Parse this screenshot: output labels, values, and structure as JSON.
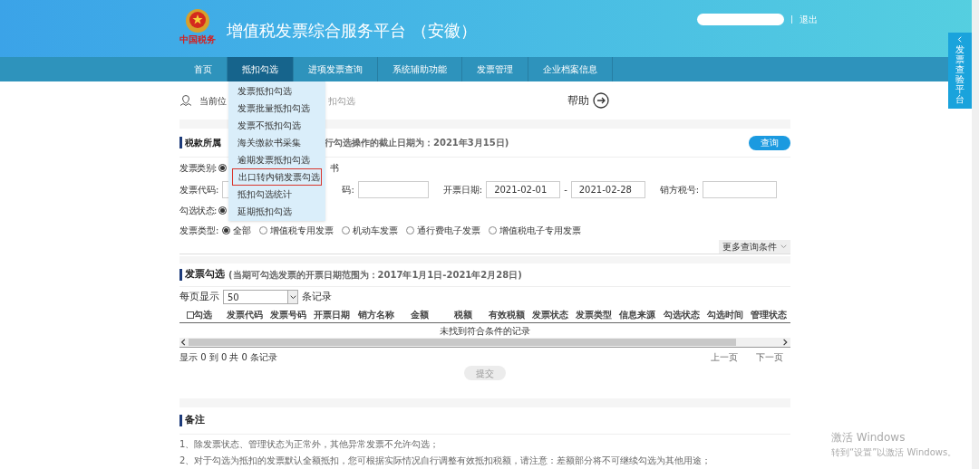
{
  "header": {
    "title": "增值税发票综合服务平台 （安徽）",
    "logo_text": "中国税务",
    "logout": "退出"
  },
  "nav": [
    {
      "label": "首页",
      "selected": false
    },
    {
      "label": "抵扣勾选",
      "selected": true
    },
    {
      "label": "进项发票查询",
      "selected": false
    },
    {
      "label": "系统辅助功能",
      "selected": false
    },
    {
      "label": "发票管理",
      "selected": false
    },
    {
      "label": "企业档案信息",
      "selected": false
    }
  ],
  "dropdown": [
    {
      "label": "发票抵扣勾选",
      "selected": false
    },
    {
      "label": "发票批量抵扣勾选",
      "selected": false
    },
    {
      "label": "发票不抵扣勾选",
      "selected": false
    },
    {
      "label": "海关缴款书采集",
      "selected": false
    },
    {
      "label": "逾期发票抵扣勾选",
      "selected": false
    },
    {
      "label": "出口转内销发票勾选",
      "selected": true
    },
    {
      "label": "抵扣勾选统计",
      "selected": false
    },
    {
      "label": "延期抵扣勾选",
      "selected": false
    }
  ],
  "breadcrumb": {
    "prefix": "当前位",
    "suffix": "扣勾选"
  },
  "help": "帮助",
  "section1": {
    "title": "税款所属",
    "note": "行勾选操作的截止日期为：2021年3月15日)",
    "query_button": "查询"
  },
  "filters": {
    "category": {
      "label": "发票类别:",
      "selected": true,
      "trailing": "书"
    },
    "code_label": "发票代码:",
    "number_label": "码:",
    "date_label": "开票日期:",
    "date_from": "2021-02-01",
    "separator": "-",
    "date_to": "2021-02-28",
    "seller_label": "销方税号:",
    "status": {
      "label": "勾选状态:",
      "selected": true
    },
    "type_label": "发票类型:",
    "types": [
      {
        "label": "全部",
        "selected": true
      },
      {
        "label": "增值税专用发票",
        "selected": false
      },
      {
        "label": "机动车发票",
        "selected": false
      },
      {
        "label": "通行费电子发票",
        "selected": false
      },
      {
        "label": "增值税电子专用发票",
        "selected": false
      }
    ],
    "more": "更多查询条件"
  },
  "section2": {
    "title": "发票勾选",
    "note": "(当期可勾选发票的开票日期范围为：2017年1月1日-2021年2月28日)",
    "page_size_label": "每页显示",
    "page_size": "50",
    "page_size_suffix": "条记录"
  },
  "table": {
    "select_all": {
      "label": "勾选",
      "checked": false
    },
    "columns": [
      "发票代码",
      "发票号码",
      "开票日期",
      "销方名称",
      "金额",
      "税额",
      "有效税额",
      "发票状态",
      "发票类型",
      "信息来源",
      "勾选状态",
      "勾选时间",
      "管理状态"
    ],
    "empty": "未找到符合条件的记录"
  },
  "pager": {
    "info": "显示 0 到 0 共 0 条记录",
    "prev": "上一页",
    "next": "下一页"
  },
  "submit": {
    "label": "提交",
    "disabled": true
  },
  "notes": {
    "title": "备注",
    "items": [
      "1、除发票状态、管理状态为正常外，其他异常发票不允许勾选；",
      "2、对于勾选为抵扣的发票默认全额抵扣，您可根据实际情况自行调整有效抵扣税额，请注意：差额部分将不可继续勾选为其他用途；"
    ]
  },
  "side_tab": "发票查验平台",
  "watermark": {
    "title": "激活 Windows",
    "subtitle": "转到“设置”以激活 Windows。"
  }
}
